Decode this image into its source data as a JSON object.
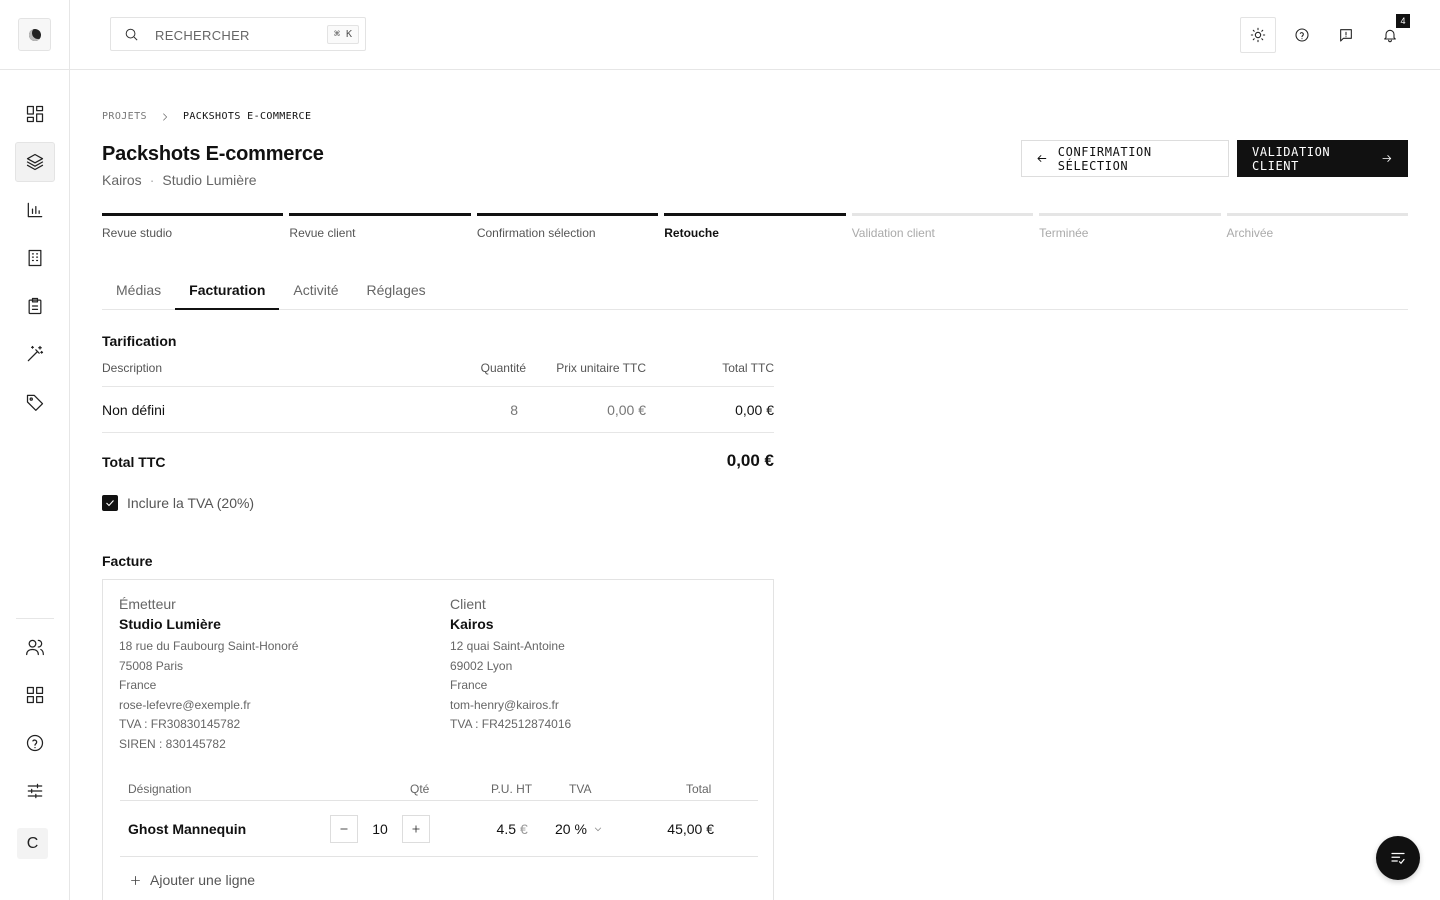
{
  "search": {
    "placeholder": "RECHERCHER",
    "shortcut": "⌘ K"
  },
  "topbar": {
    "notification_count": "4"
  },
  "sidebar": {
    "avatar_initial": "C",
    "items": [
      {
        "icon": "dashboard-icon"
      },
      {
        "icon": "layers-icon",
        "active": true
      },
      {
        "icon": "bar-chart-icon"
      },
      {
        "icon": "building-icon"
      },
      {
        "icon": "clipboard-icon"
      },
      {
        "icon": "magic-wand-icon"
      },
      {
        "icon": "tag-icon"
      }
    ],
    "bottom_items": [
      {
        "icon": "users-icon"
      },
      {
        "icon": "apps-grid-icon"
      },
      {
        "icon": "help-circle-icon"
      },
      {
        "icon": "sliders-icon"
      }
    ]
  },
  "breadcrumb": {
    "parent": "PROJETS",
    "current": "PACKSHOTS E-COMMERCE"
  },
  "project": {
    "title": "Packshots E-commerce",
    "client": "Kairos",
    "separator": "·",
    "studio": "Studio Lumière"
  },
  "actions": {
    "back_label": "CONFIRMATION SÉLECTION",
    "next_label": "VALIDATION CLIENT"
  },
  "steps": [
    {
      "label": "Revue studio",
      "state": "done"
    },
    {
      "label": "Revue client",
      "state": "done"
    },
    {
      "label": "Confirmation sélection",
      "state": "done"
    },
    {
      "label": "Retouche",
      "state": "current"
    },
    {
      "label": "Validation client",
      "state": "todo"
    },
    {
      "label": "Terminée",
      "state": "todo"
    },
    {
      "label": "Archivée",
      "state": "todo"
    }
  ],
  "tabs": [
    {
      "label": "Médias"
    },
    {
      "label": "Facturation",
      "active": true
    },
    {
      "label": "Activité"
    },
    {
      "label": "Réglages"
    }
  ],
  "pricing": {
    "title": "Tarification",
    "headers": {
      "description": "Description",
      "quantity": "Quantité",
      "unit_price": "Prix unitaire TTC",
      "total": "Total TTC"
    },
    "row": {
      "description": "Non défini",
      "quantity": "8",
      "unit_price": "0,00 €",
      "total": "0,00 €"
    },
    "total_label": "Total TTC",
    "total_value": "0,00 €",
    "vat_checkbox_label": "Inclure la TVA (20%)"
  },
  "invoice": {
    "title": "Facture",
    "issuer": {
      "role": "Émetteur",
      "name": "Studio Lumière",
      "address": "18 rue du Faubourg Saint-Honoré",
      "city": "75008 Paris",
      "country": "France",
      "email": "rose-lefevre@exemple.fr",
      "vat": "TVA : FR30830145782",
      "siren": "SIREN : 830145782"
    },
    "client": {
      "role": "Client",
      "name": "Kairos",
      "address": "12 quai Saint-Antoine",
      "city": "69002 Lyon",
      "country": "France",
      "email": "tom-henry@kairos.fr",
      "vat": "TVA : FR42512874016"
    },
    "headers": {
      "designation": "Désignation",
      "qty": "Qté",
      "unit_price": "P.U. HT",
      "vat": "TVA",
      "total": "Total"
    },
    "line": {
      "designation": "Ghost Mannequin",
      "qty": "10",
      "unit_price": "4.5",
      "currency": "€",
      "vat": "20 %",
      "total": "45,00 €"
    },
    "add_line_label": "Ajouter une ligne"
  }
}
